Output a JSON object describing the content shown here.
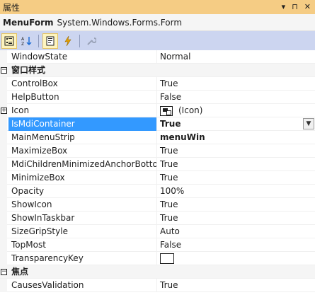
{
  "panel": {
    "title": "属性",
    "controls": {
      "dropdown": "▾",
      "pin": "⊓",
      "close": "✕"
    }
  },
  "object": {
    "name": "MenuForm",
    "type": "System.Windows.Forms.Form"
  },
  "toolbar": {
    "buttons": [
      "categorized-icon",
      "alphabetical-icon",
      "properties-icon",
      "events-icon",
      "property-pages-icon"
    ]
  },
  "rows": {
    "r0": {
      "name": "WindowState",
      "value": "Normal"
    },
    "cat1": {
      "label": "窗口样式",
      "toggle": "−"
    },
    "r1": {
      "name": "ControlBox",
      "value": "True"
    },
    "r2": {
      "name": "HelpButton",
      "value": "False"
    },
    "r3": {
      "name": "Icon",
      "value": "(Icon)",
      "toggle": "+"
    },
    "r4": {
      "name": "IsMdiContainer",
      "value": "True"
    },
    "r5": {
      "name": "MainMenuStrip",
      "value": "menuWin"
    },
    "r6": {
      "name": "MaximizeBox",
      "value": "True"
    },
    "r7": {
      "name": "MdiChildrenMinimizedAnchorBottom",
      "value": "True"
    },
    "r8": {
      "name": "MinimizeBox",
      "value": "True"
    },
    "r9": {
      "name": "Opacity",
      "value": "100%"
    },
    "r10": {
      "name": "ShowIcon",
      "value": "True"
    },
    "r11": {
      "name": "ShowInTaskbar",
      "value": "True"
    },
    "r12": {
      "name": "SizeGripStyle",
      "value": "Auto"
    },
    "r13": {
      "name": "TopMost",
      "value": "False"
    },
    "r14": {
      "name": "TransparencyKey",
      "value": "",
      "color": "#ffffff"
    },
    "cat2": {
      "label": "焦点",
      "toggle": "−"
    },
    "r15": {
      "name": "CausesValidation",
      "value": "True"
    }
  },
  "colors": {
    "selection": "#3399ff",
    "toolbar": "#ccd5f0",
    "titlebar": "#f5cc84"
  }
}
